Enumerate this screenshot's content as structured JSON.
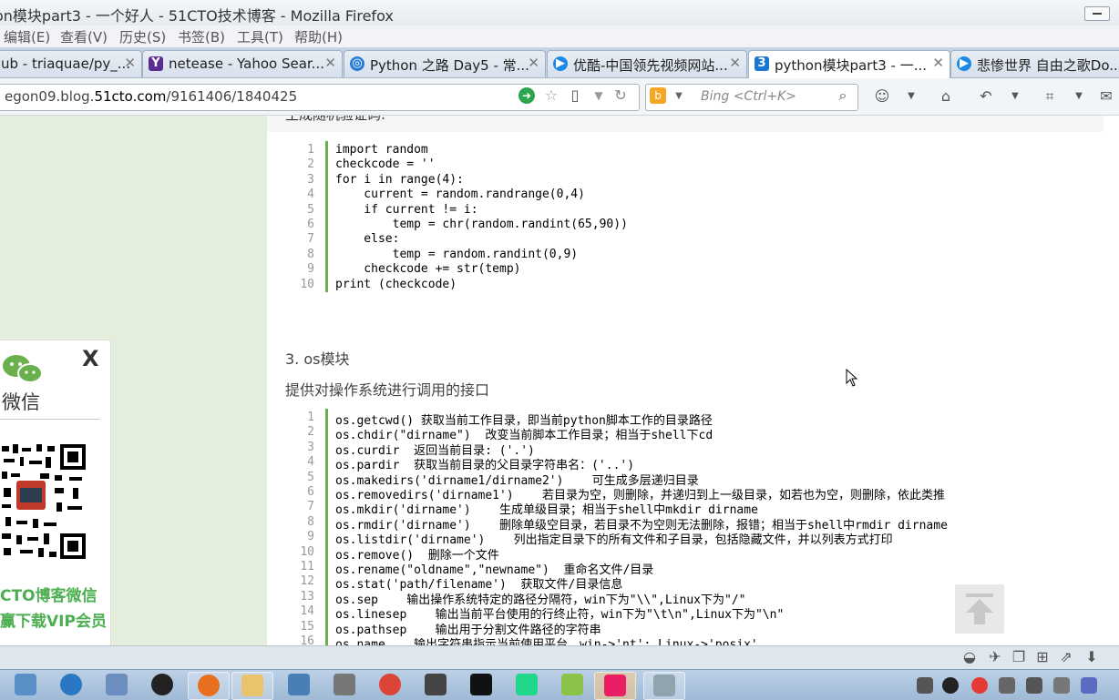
{
  "window": {
    "title": "on模块part3 - 一个好人 - 51CTO技术博客 - Mozilla Firefox"
  },
  "menubar": [
    "编辑(E)",
    "查看(V)",
    "历史(S)",
    "书签(B)",
    "工具(T)",
    "帮助(H)"
  ],
  "tabs": [
    {
      "label": "ub - triaquae/py_...",
      "icon": "github-icon"
    },
    {
      "label": "netease - Yahoo Sear...",
      "icon": "yahoo-icon"
    },
    {
      "label": "Python 之路 Day5 - 常...",
      "icon": "site-icon"
    },
    {
      "label": "优酷-中国领先视频网站...",
      "icon": "youku-icon"
    },
    {
      "label": "python模块part3 - 一...",
      "icon": "51cto-icon",
      "active": true
    },
    {
      "label": "悲惨世界 自由之歌Do...",
      "icon": "youku-icon"
    }
  ],
  "nav": {
    "url_prefix": "egon09.blog.",
    "url_domain": "51cto.com",
    "url_path": "/9161406/1840425",
    "search_engine": "Bing",
    "search_placeholder": "Bing  <Ctrl+K>"
  },
  "article": {
    "top_heading": "生成随机验证码:",
    "code1": [
      {
        "n": "1",
        "t": "import random"
      },
      {
        "n": "2",
        "t": "checkcode = ''"
      },
      {
        "n": "3",
        "t": "for i in range(4):"
      },
      {
        "n": "4",
        "t": "    current = random.randrange(0,4)"
      },
      {
        "n": "5",
        "t": "    if current != i:"
      },
      {
        "n": "6",
        "t": "        temp = chr(random.randint(65,90))"
      },
      {
        "n": "7",
        "t": "    else:"
      },
      {
        "n": "8",
        "t": "        temp = random.randint(0,9)"
      },
      {
        "n": "9",
        "t": "    checkcode += str(temp)"
      },
      {
        "n": "10",
        "t": "print (checkcode)"
      }
    ],
    "section_title": "3. os模块",
    "section_desc": "提供对操作系统进行调用的接口",
    "code2": [
      {
        "n": "1",
        "t": "os.getcwd() 获取当前工作目录，即当前python脚本工作的目录路径"
      },
      {
        "n": "2",
        "t": "os.chdir(\"dirname\")  改变当前脚本工作目录；相当于shell下cd"
      },
      {
        "n": "3",
        "t": "os.curdir  返回当前目录: ('.')"
      },
      {
        "n": "4",
        "t": "os.pardir  获取当前目录的父目录字符串名：('..')"
      },
      {
        "n": "5",
        "t": "os.makedirs('dirname1/dirname2')    可生成多层递归目录"
      },
      {
        "n": "6",
        "t": "os.removedirs('dirname1')    若目录为空，则删除，并递归到上一级目录，如若也为空，则删除，依此类推"
      },
      {
        "n": "7",
        "t": "os.mkdir('dirname')    生成单级目录；相当于shell中mkdir dirname"
      },
      {
        "n": "8",
        "t": "os.rmdir('dirname')    删除单级空目录，若目录不为空则无法删除，报错；相当于shell中rmdir dirname"
      },
      {
        "n": "9",
        "t": "os.listdir('dirname')    列出指定目录下的所有文件和子目录，包括隐藏文件，并以列表方式打印"
      },
      {
        "n": "10",
        "t": "os.remove()  删除一个文件"
      },
      {
        "n": "11",
        "t": "os.rename(\"oldname\",\"newname\")  重命名文件/目录"
      },
      {
        "n": "12",
        "t": "os.stat('path/filename')  获取文件/目录信息"
      },
      {
        "n": "13",
        "t": "os.sep    输出操作系统特定的路径分隔符，win下为\"\\\\\",Linux下为\"/\""
      },
      {
        "n": "14",
        "t": "os.linesep    输出当前平台使用的行终止符，win下为\"\\t\\n\",Linux下为\"\\n\""
      },
      {
        "n": "15",
        "t": "os.pathsep    输出用于分割文件路径的字符串"
      },
      {
        "n": "16",
        "t": "os.name    输出字符串指示当前使用平台。win->'nt'; Linux->'posix'"
      }
    ]
  },
  "wechat_widget": {
    "title": "微信",
    "close_label": "X",
    "line1": "CTO博客微信",
    "line2": "赢下载VIP会员"
  },
  "colors": {
    "accent_green": "#6ab04c",
    "link_green": "#4caf50",
    "sidebar_bg": "#e4eedc"
  }
}
